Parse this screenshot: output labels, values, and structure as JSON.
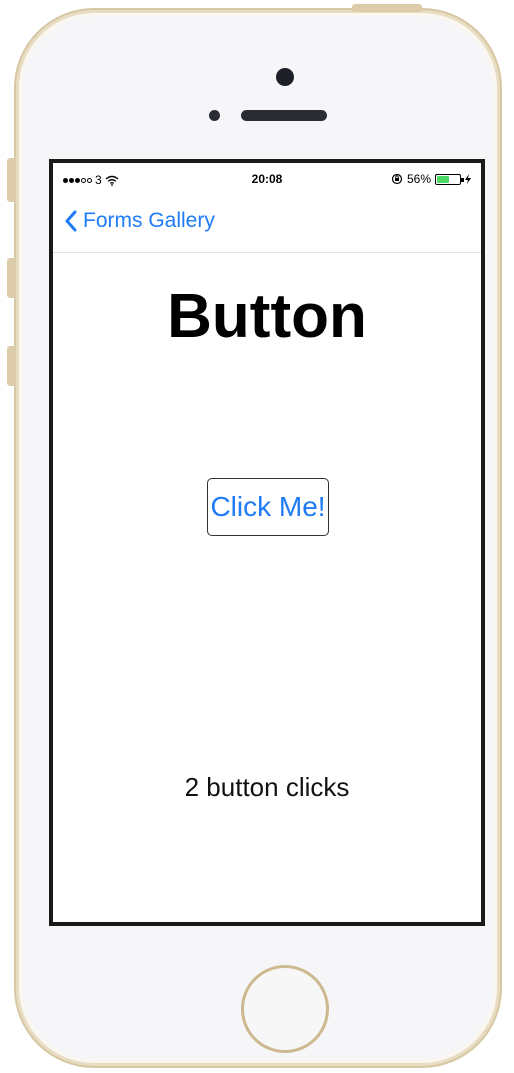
{
  "status_bar": {
    "carrier": "3",
    "time": "20:08",
    "battery_text": "56%",
    "battery_level": 0.56,
    "wifi_icon": "wifi-icon",
    "lock_icon": "orientation-lock-icon",
    "charging_icon": "charging-bolt-icon"
  },
  "nav": {
    "back_label": "Forms Gallery",
    "back_icon": "chevron-left-icon"
  },
  "page": {
    "title": "Button",
    "button_label": "Click Me!",
    "click_count_text": "2 button clicks"
  },
  "colors": {
    "accent": "#1f7bf6",
    "battery": "#4cd964"
  }
}
